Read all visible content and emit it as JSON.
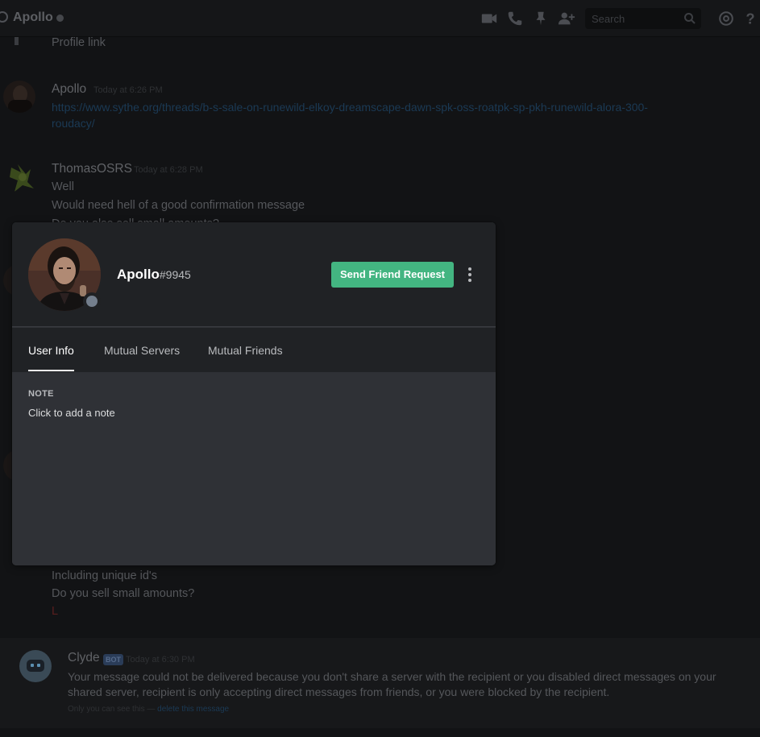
{
  "topbar": {
    "title": "Apollo",
    "search_placeholder": "Search",
    "icons": [
      "video-call-icon",
      "voice-call-icon",
      "pin-icon",
      "add-friend-icon",
      "search-icon",
      "mentions-icon",
      "help-icon"
    ]
  },
  "chat": {
    "messages": [
      {
        "text": "Profile link"
      },
      {
        "author": "Apollo",
        "time": "Today at 6:26 PM",
        "link_line1": "https://www.sythe.org/threads/b-s-sale-on-runewild-elkoy-dreamscape-dawn-spk-oss-roatpk-sp-pkh-runewild-alora-300-",
        "link_line2": "roudacy/"
      },
      {
        "author": "ThomasOSRS",
        "time": "Today at 6:28 PM",
        "lines": [
          "Well",
          "Would need hell of a good confirmation message",
          "Do you also sell small amounts?"
        ]
      },
      {
        "lines": [
          "Including unique id's",
          "Do you sell small amounts?",
          "L"
        ]
      }
    ],
    "clyde": {
      "author": "Clyde",
      "bot_tag": "BOT",
      "time": "Today at 6:30 PM",
      "line1": "Your message could not be delivered because you don't share a server with the recipient or you disabled direct messages on your",
      "line2": "shared server, recipient is only accepting direct messages from friends, or you were blocked by the recipient.",
      "note_prefix": "Only you can see this —",
      "note_link": "delete this message"
    }
  },
  "profile": {
    "username": "Apollo",
    "discriminator": "#9945",
    "status": "offline",
    "send_button": "Send Friend Request",
    "tabs": [
      "User Info",
      "Mutual Servers",
      "Mutual Friends"
    ],
    "active_tab": "User Info",
    "note_label": "NOTE",
    "note_placeholder": "Click to add a note"
  },
  "colors": {
    "accent_green": "#43b581",
    "modal_bg": "#2f3136",
    "modal_header": "#202225",
    "status_offline": "#747f8d"
  }
}
